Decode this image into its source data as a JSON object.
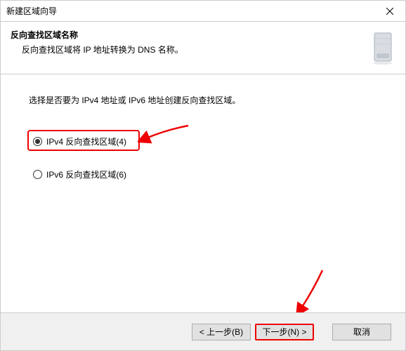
{
  "titlebar": {
    "title": "新建区域向导"
  },
  "header": {
    "title": "反向查找区域名称",
    "subtitle": "反向查找区域将 IP 地址转换为 DNS 名称。"
  },
  "body": {
    "instruction": "选择是否要为 IPv4 地址或 IPv6 地址创建反向查找区域。",
    "options": [
      {
        "label": "IPv4 反向查找区域(4)",
        "selected": true
      },
      {
        "label": "IPv6 反向查找区域(6)",
        "selected": false
      }
    ]
  },
  "footer": {
    "back": "< 上一步(B)",
    "next": "下一步(N) >",
    "cancel": "取消"
  }
}
